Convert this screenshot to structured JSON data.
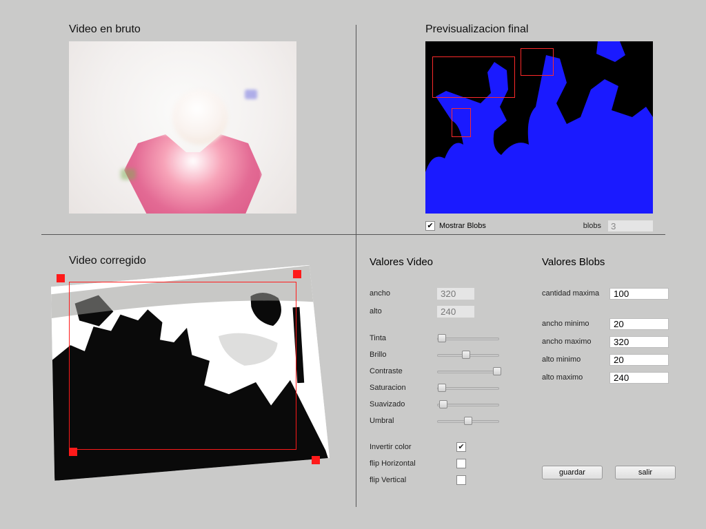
{
  "sections": {
    "raw_video": "Video en bruto",
    "final_preview": "Previsualizacion final",
    "corrected_video": "Video corregido",
    "values_video": "Valores Video",
    "values_blobs": "Valores Blobs"
  },
  "blobs_bar": {
    "show_blobs_label": "Mostrar Blobs",
    "show_blobs_checked": true,
    "count_label": "blobs",
    "count_value": "3"
  },
  "video_values": {
    "width_label": "ancho",
    "width_value": "320",
    "height_label": "alto",
    "height_value": "240",
    "tint_label": "Tinta",
    "tint_pos": 0.08,
    "brightness_label": "Brillo",
    "brightness_pos": 0.47,
    "contrast_label": "Contraste",
    "contrast_pos": 0.97,
    "saturation_label": "Saturacion",
    "saturation_pos": 0.08,
    "smoothing_label": "Suavizado",
    "smoothing_pos": 0.1,
    "threshold_label": "Umbral",
    "threshold_pos": 0.5,
    "invert_label": "Invertir color",
    "invert_checked": true,
    "flip_h_label": "flip Horizontal",
    "flip_h_checked": false,
    "flip_v_label": "flip Vertical",
    "flip_v_checked": false
  },
  "blob_values": {
    "max_count_label": "cantidad maxima",
    "max_count_value": "100",
    "min_w_label": "ancho minimo",
    "min_w_value": "20",
    "max_w_label": "ancho maximo",
    "max_w_value": "320",
    "min_h_label": "alto minimo",
    "min_h_value": "20",
    "max_h_label": "alto maximo",
    "max_h_value": "240"
  },
  "buttons": {
    "save": "guardar",
    "exit": "salir"
  },
  "colors": {
    "blob_fill": "#1a1aff",
    "blob_box": "#ff2a2a",
    "bg": "#cacac9"
  }
}
